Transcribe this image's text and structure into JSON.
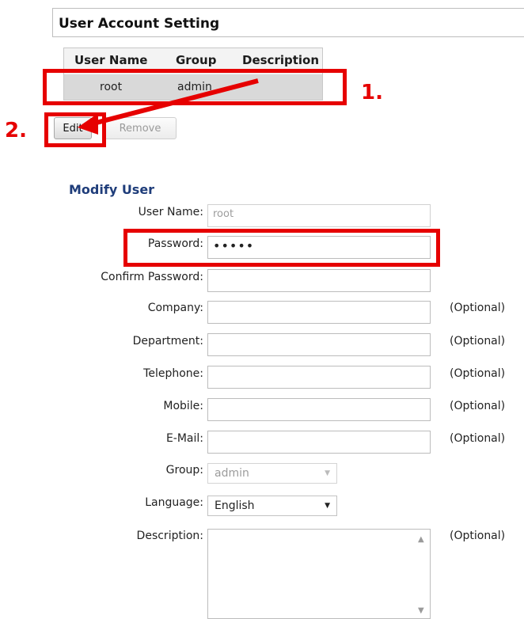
{
  "header": {
    "title": "User Account Setting"
  },
  "table": {
    "columns": [
      "User Name",
      "Group",
      "Description"
    ],
    "rows": [
      {
        "user_name": "root",
        "group": "admin",
        "description": ""
      }
    ]
  },
  "buttons": {
    "edit": "Edit",
    "remove": "Remove"
  },
  "annotations": {
    "step1": "1.",
    "step2": "2."
  },
  "form": {
    "title": "Modify User",
    "optional_text": "(Optional)",
    "user_name": {
      "label": "User Name:",
      "value": "root"
    },
    "password": {
      "label": "Password:",
      "value": "•••••"
    },
    "confirm_password": {
      "label": "Confirm Password:",
      "value": ""
    },
    "company": {
      "label": "Company:",
      "value": ""
    },
    "department": {
      "label": "Department:",
      "value": ""
    },
    "telephone": {
      "label": "Telephone:",
      "value": ""
    },
    "mobile": {
      "label": "Mobile:",
      "value": ""
    },
    "email": {
      "label": "E-Mail:",
      "value": ""
    },
    "group": {
      "label": "Group:",
      "value": "admin"
    },
    "language": {
      "label": "Language:",
      "value": "English"
    },
    "description": {
      "label": "Description:",
      "value": ""
    }
  },
  "colors": {
    "annotation_red": "#e60000",
    "section_title": "#1f3d7a"
  }
}
